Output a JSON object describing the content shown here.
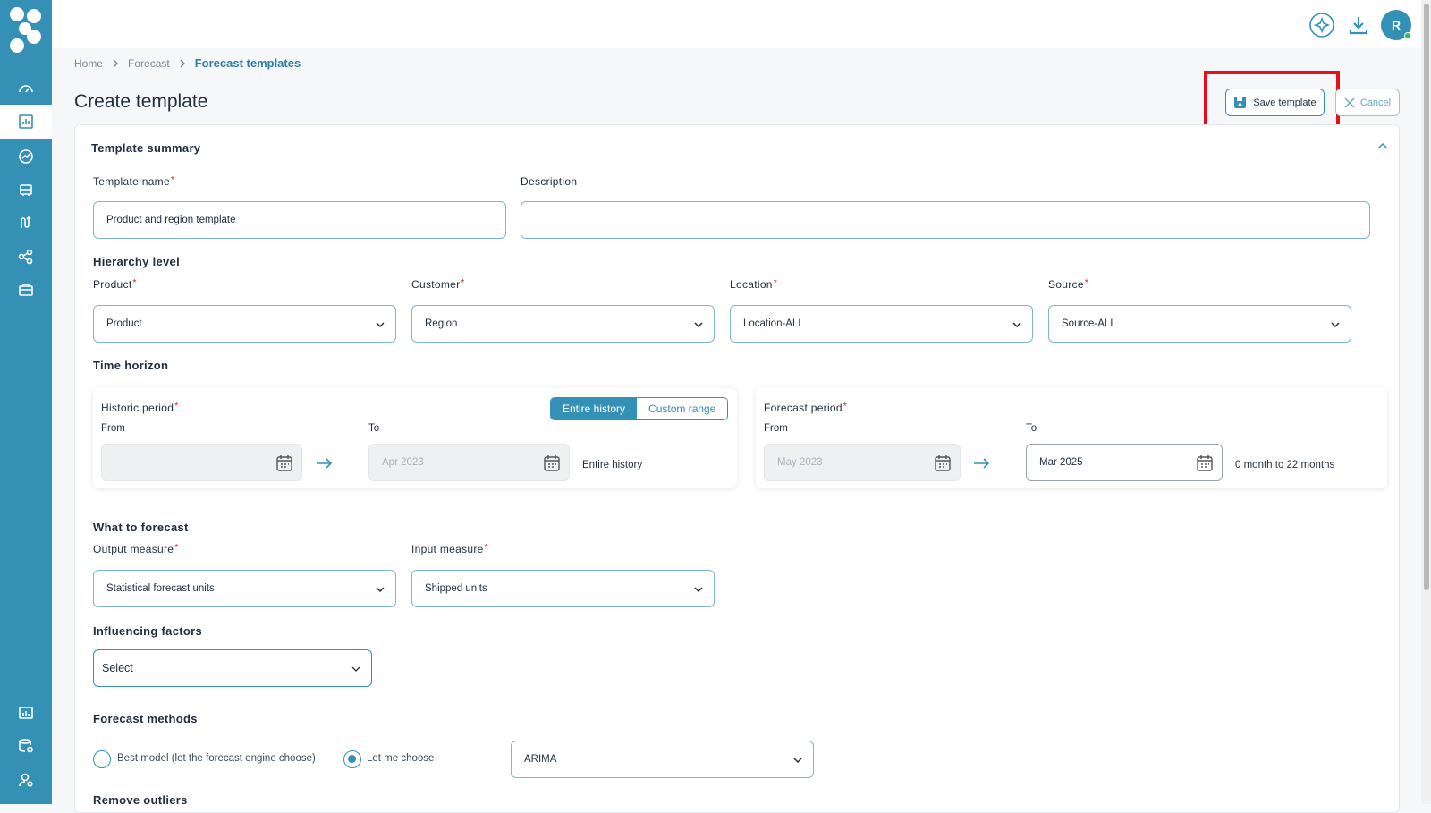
{
  "breadcrumb": {
    "home": "Home",
    "forecast": "Forecast",
    "current": "Forecast templates"
  },
  "page_title": "Create template",
  "header": {
    "avatar_initial": "R"
  },
  "actions": {
    "save_label": "Save template",
    "cancel_label": "Cancel"
  },
  "summary": {
    "title": "Template summary",
    "template_name_label": "Template name",
    "template_name_value": "Product and region template",
    "description_label": "Description",
    "description_value": ""
  },
  "hierarchy": {
    "title": "Hierarchy level",
    "fields": [
      {
        "label": "Product",
        "value": "Product"
      },
      {
        "label": "Customer",
        "value": "Region"
      },
      {
        "label": "Location",
        "value": "Location-ALL"
      },
      {
        "label": "Source",
        "value": "Source-ALL"
      }
    ]
  },
  "time_horizon": {
    "title": "Time horizon",
    "historic": {
      "label": "Historic period",
      "toggle_on": "Entire history",
      "toggle_off": "Custom range",
      "from_label": "From",
      "from_value": "",
      "to_label": "To",
      "to_value": "Apr 2023",
      "summary": "Entire history"
    },
    "forecast": {
      "label": "Forecast period",
      "from_label": "From",
      "from_value": "May 2023",
      "to_label": "To",
      "to_value": "Mar 2025",
      "summary": "0 month to 22 months"
    }
  },
  "what_to_forecast": {
    "title": "What to forecast",
    "output_label": "Output measure",
    "output_value": "Statistical forecast units",
    "input_label": "Input measure",
    "input_value": "Shipped units"
  },
  "influencing": {
    "title": "Influencing factors",
    "value": "Select"
  },
  "methods": {
    "title": "Forecast methods",
    "option_best": "Best model (let the forecast engine choose)",
    "option_choose": "Let me choose",
    "selected_method": "ARIMA"
  },
  "outliers": {
    "title": "Remove outliers"
  },
  "colors": {
    "sidebar": "#3590b6",
    "accent": "#3590b6",
    "highlight": "#e3101a"
  }
}
